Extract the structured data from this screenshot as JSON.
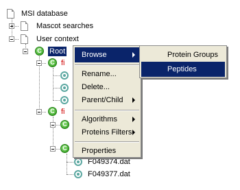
{
  "tree": {
    "msi_database": "MSI database",
    "mascot_searches": "Mascot searches",
    "user_context": "User context",
    "root": "Root",
    "child_1_partial": "fi",
    "child_2_partial": "fi",
    "file_1": "F049374.dat",
    "file_2": "F049377.dat"
  },
  "context_menu": {
    "browse": "Browse",
    "rename": "Rename...",
    "delete": "Delete...",
    "parent_child": "Parent/Child",
    "algorithms": "Algorithms",
    "proteins_filters": "Proteins Filters",
    "properties": "Properties"
  },
  "submenu": {
    "protein_groups": "Protein Groups",
    "peptides": "Peptides"
  },
  "colors": {
    "selection": "#0a246a",
    "menu_bg": "#ece9d8",
    "red_text": "#d00000"
  }
}
